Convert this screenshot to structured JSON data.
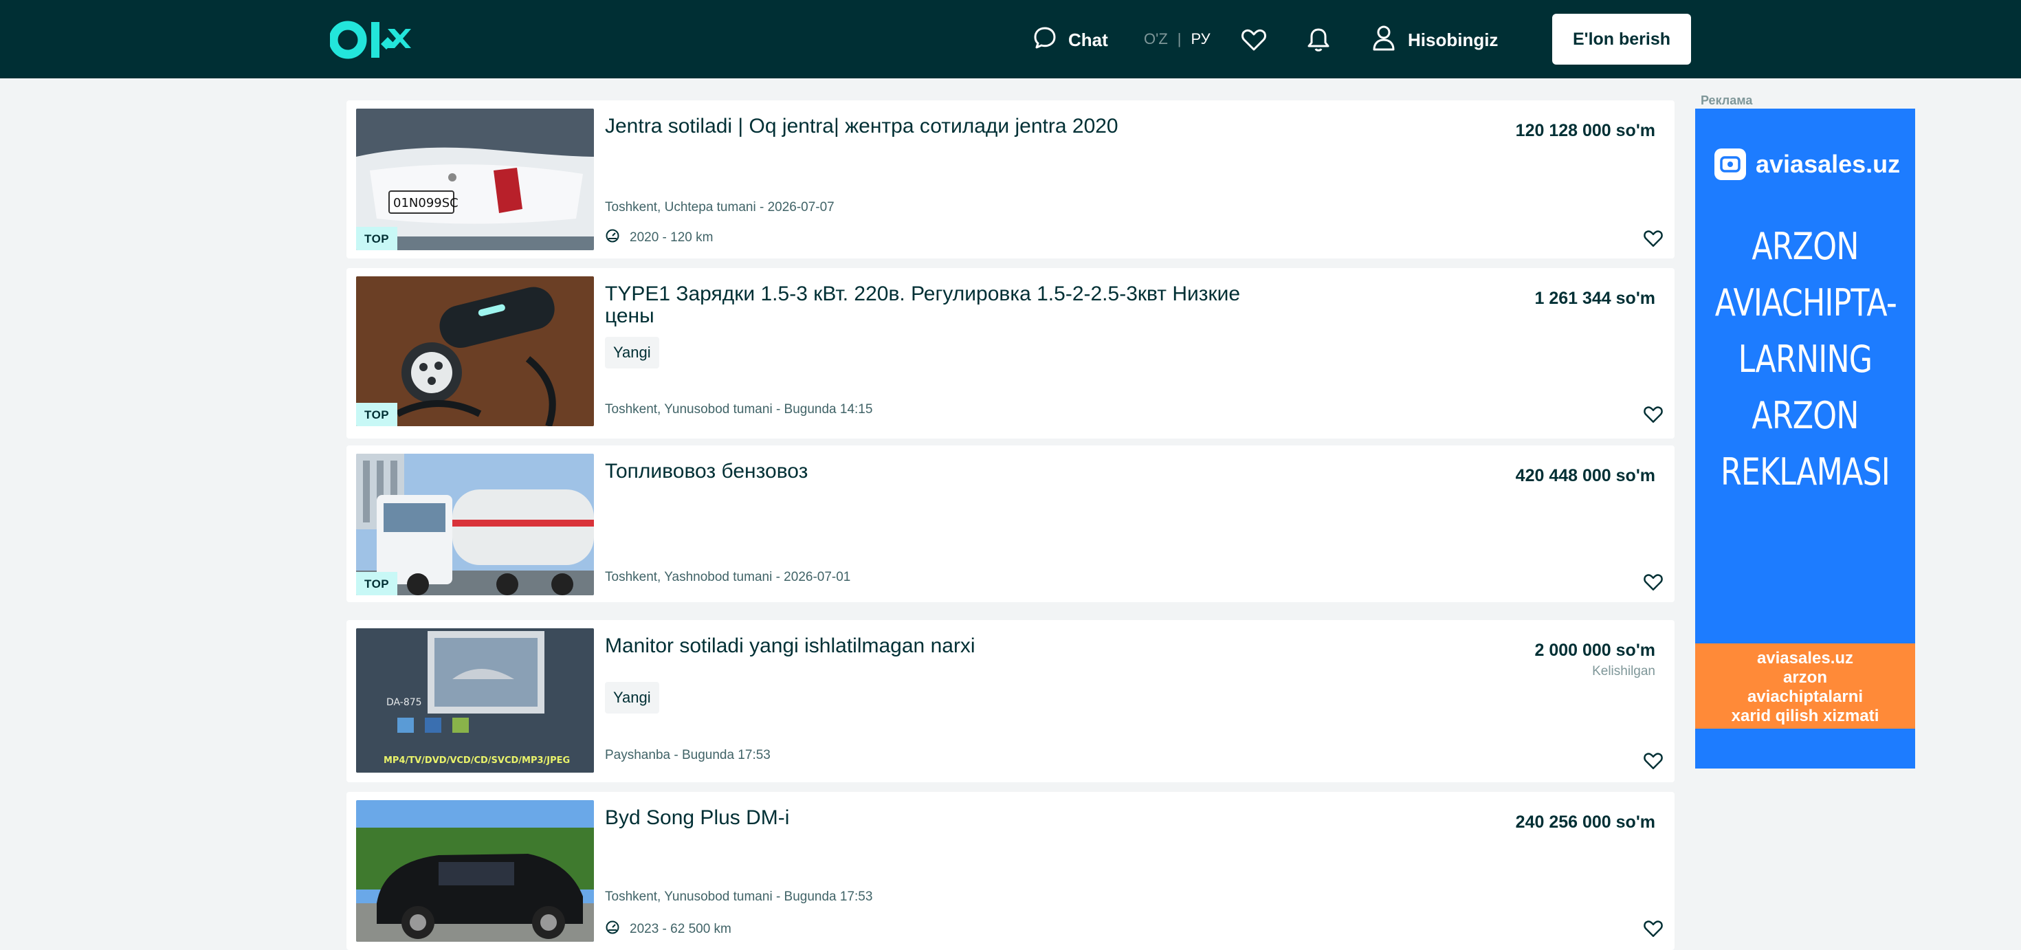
{
  "header": {
    "chat_label": "Chat",
    "lang_oz": "O'Z",
    "lang_sep": "|",
    "lang_ru": "РУ",
    "account_label": "Hisobingiz",
    "post_button": "E'lon berish"
  },
  "listings": [
    {
      "title": "Jentra sotiladi | Oq jentra| жентра сотилади jentra 2020",
      "price": "120 128 000 so'm",
      "location": "Toshkent, Uchtepa tumani - 2026-07-07",
      "meta": "2020 - 120 km",
      "badge": "TOP"
    },
    {
      "title": "TYPE1 Зарядки 1.5-3 кВт. 220в. Регулировка 1.5-2-2.5-3квт Низкие цены",
      "price": "1 261 344 so'm",
      "tag": "Yangi",
      "location": "Toshkent, Yunusobod tumani - Bugunda 14:15",
      "badge": "TOP"
    },
    {
      "title": "Топливовоз бензовоз",
      "price": "420 448 000 so'm",
      "location": "Toshkent, Yashnobod tumani - 2026-07-01",
      "badge": "TOP"
    },
    {
      "title": "Manitor sotiladi yangi ishlatilmagan narxi",
      "price": "2 000 000 so'm",
      "negotiable": "Kelishilgan",
      "tag": "Yangi",
      "location": "Payshanba - Bugunda 17:53"
    },
    {
      "title": "Byd Song Plus DM-i",
      "price": "240 256 000 so'm",
      "location": "Toshkent, Yunusobod tumani - Bugunda 17:53",
      "meta": "2023 - 62 500 km"
    }
  ],
  "ad": {
    "label": "Реклама",
    "brand": "aviasales.uz",
    "headline": [
      "ARZON",
      "AVIACHIPTA-",
      "LARNING",
      "ARZON",
      "REKLAMASI"
    ],
    "footer": [
      "aviasales.uz",
      "arzon",
      "aviachiptalarni",
      "xarid qilish xizmati"
    ]
  },
  "colors": {
    "header_bg": "#002f34",
    "logo_accent": "#23e5db",
    "ad_blue": "#1d7cff",
    "ad_orange": "#ff8a38",
    "top_badge": "#c8f8f6"
  }
}
